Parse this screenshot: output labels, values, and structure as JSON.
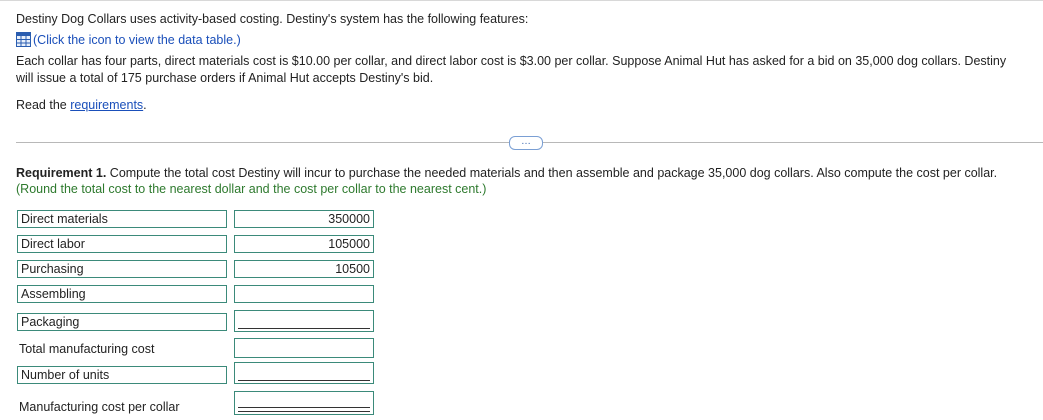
{
  "intro": "Destiny Dog Collars uses activity-based costing. Destiny's system has the following features:",
  "data_link": "(Click the icon to view the data table.)",
  "description_line1": "Each collar has four parts, direct materials cost is $10.00 per collar, and direct labor cost is $3.00 per collar. Suppose Animal Hut has asked for a bid on 35,000 dog collars. Destiny",
  "description_line2": "will issue a total of 175 purchase orders if Animal Hut accepts Destiny's bid.",
  "read_prefix": "Read the ",
  "read_link": "requirements",
  "read_suffix": ".",
  "more_button": "…",
  "requirement": {
    "label": "Requirement 1.",
    "text": " Compute the total cost Destiny will incur to purchase the needed materials and then assemble and package 35,000 dog collars. Also compute the cost per collar.",
    "rounding": "(Round the total cost to the nearest dollar and the cost per collar to the nearest cent.)"
  },
  "rows": [
    {
      "label": "Direct materials",
      "value": "350000"
    },
    {
      "label": "Direct labor",
      "value": "105000"
    },
    {
      "label": "Purchasing",
      "value": "10500"
    },
    {
      "label": "Assembling",
      "value": ""
    },
    {
      "label": "Packaging",
      "value": ""
    },
    {
      "label": "Total manufacturing cost",
      "value": ""
    },
    {
      "label": "Number of units",
      "value": ""
    },
    {
      "label": "Manufacturing cost per collar",
      "value": ""
    }
  ],
  "icons": {
    "data_table": "table-grid-icon"
  }
}
